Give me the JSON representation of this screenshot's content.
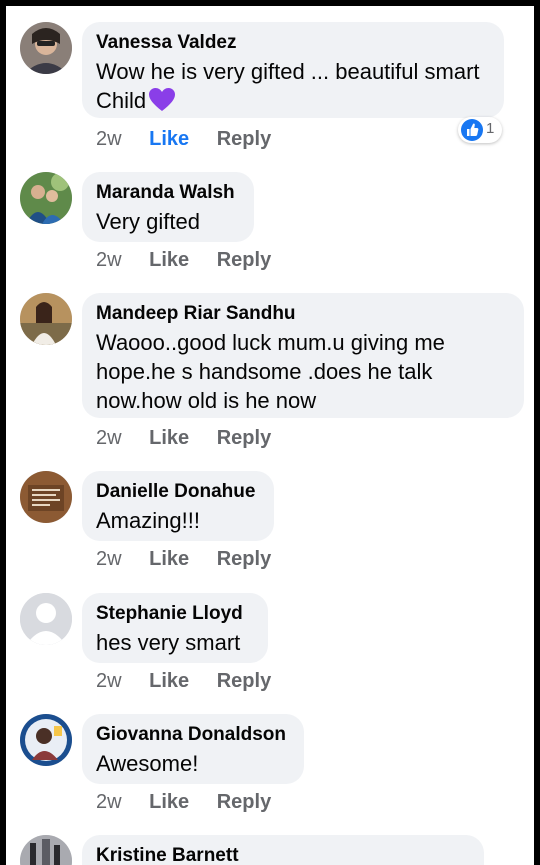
{
  "colors": {
    "bubble": "#f0f2f5",
    "like_active": "#1877f2",
    "meta_text": "#65676b",
    "name_text": "#050505"
  },
  "comments": [
    {
      "author": "Vanessa Valdez",
      "text": "Wow he is very gifted ... beautiful smart Child",
      "emoji": "purple-heart",
      "time": "2w",
      "like_label": "Like",
      "reply_label": "Reply",
      "liked": true,
      "reaction_count": "1"
    },
    {
      "author": "Maranda Walsh",
      "text": "Very gifted",
      "time": "2w",
      "like_label": "Like",
      "reply_label": "Reply"
    },
    {
      "author": "Mandeep Riar Sandhu",
      "text": "Waooo..good luck mum.u giving me hope.he s handsome .does he talk now.how old is he now",
      "time": "2w",
      "like_label": "Like",
      "reply_label": "Reply"
    },
    {
      "author": "Danielle Donahue",
      "text": "Amazing!!!",
      "time": "2w",
      "like_label": "Like",
      "reply_label": "Reply"
    },
    {
      "author": "Stephanie Lloyd",
      "text": "hes very smart",
      "time": "2w",
      "like_label": "Like",
      "reply_label": "Reply"
    },
    {
      "author": "Giovanna Donaldson",
      "text": "Awesome!",
      "time": "2w",
      "like_label": "Like",
      "reply_label": "Reply"
    },
    {
      "author": "Kristine Barnett"
    }
  ]
}
